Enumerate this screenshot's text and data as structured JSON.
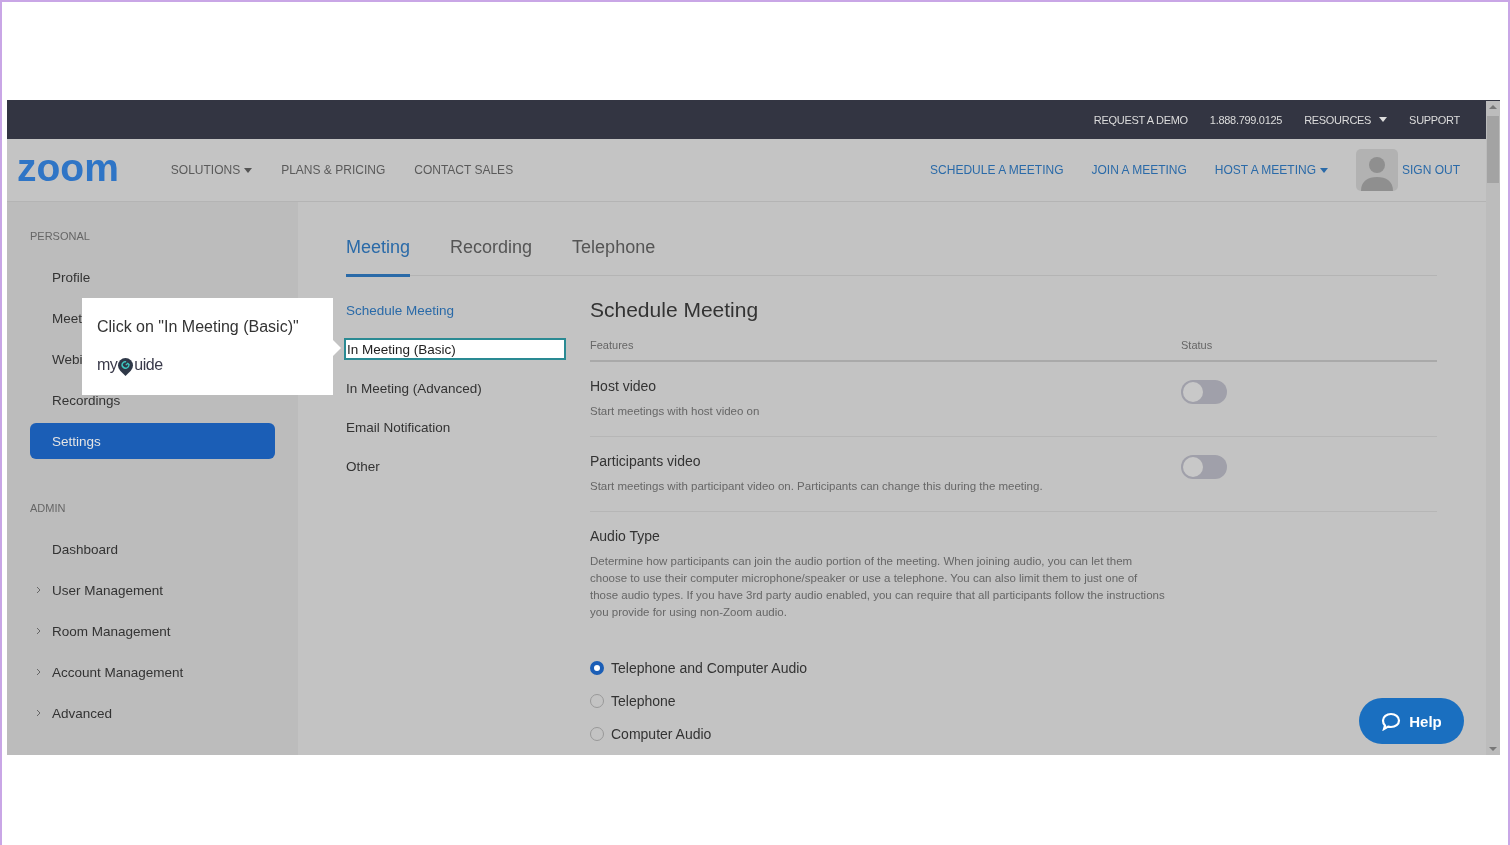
{
  "top_bar": {
    "links": [
      {
        "label": "REQUEST A DEMO",
        "dropdown": false
      },
      {
        "label": "1.888.799.0125",
        "dropdown": false
      },
      {
        "label": "RESOURCES",
        "dropdown": true
      },
      {
        "label": "SUPPORT",
        "dropdown": false
      }
    ]
  },
  "nav": {
    "logo": "zoom",
    "left": [
      {
        "label": "SOLUTIONS",
        "dropdown": true
      },
      {
        "label": "PLANS & PRICING",
        "dropdown": false
      },
      {
        "label": "CONTACT SALES",
        "dropdown": false
      }
    ],
    "right": [
      {
        "label": "SCHEDULE A MEETING",
        "dropdown": false
      },
      {
        "label": "JOIN A MEETING",
        "dropdown": false
      },
      {
        "label": "HOST A MEETING",
        "dropdown": true
      }
    ],
    "sign_out": "SIGN OUT"
  },
  "sidebar": {
    "sections": [
      {
        "heading": "PERSONAL",
        "items": [
          {
            "label": "Profile",
            "selected": false,
            "expandable": false
          },
          {
            "label": "Meet",
            "selected": false,
            "expandable": false
          },
          {
            "label": "Webi",
            "selected": false,
            "expandable": false
          },
          {
            "label": "Recordings",
            "selected": false,
            "expandable": false
          },
          {
            "label": "Settings",
            "selected": true,
            "expandable": false
          }
        ]
      },
      {
        "heading": "ADMIN",
        "items": [
          {
            "label": "Dashboard",
            "selected": false,
            "expandable": false
          },
          {
            "label": "User Management",
            "selected": false,
            "expandable": true
          },
          {
            "label": "Room Management",
            "selected": false,
            "expandable": true
          },
          {
            "label": "Account Management",
            "selected": false,
            "expandable": true
          },
          {
            "label": "Advanced",
            "selected": false,
            "expandable": true
          }
        ]
      }
    ]
  },
  "tabs": [
    {
      "label": "Meeting",
      "selected": true
    },
    {
      "label": "Recording",
      "selected": false
    },
    {
      "label": "Telephone",
      "selected": false
    }
  ],
  "subnav": [
    {
      "label": "Schedule Meeting",
      "selected": true,
      "highlighted": false
    },
    {
      "label": "In Meeting (Basic)",
      "selected": false,
      "highlighted": true
    },
    {
      "label": "In Meeting (Advanced)",
      "selected": false,
      "highlighted": false
    },
    {
      "label": "Email Notification",
      "selected": false,
      "highlighted": false
    },
    {
      "label": "Other",
      "selected": false,
      "highlighted": false
    }
  ],
  "section": {
    "title": "Schedule Meeting",
    "columns": [
      "Features",
      "Status"
    ],
    "settings": [
      {
        "kind": "toggle",
        "name": "Host video",
        "description": "Start meetings with host video on",
        "on": false
      },
      {
        "kind": "toggle",
        "name": "Participants video",
        "description": "Start meetings with participant video on. Participants can change this during the meeting.",
        "on": false
      },
      {
        "kind": "radio",
        "name": "Audio Type",
        "description": "Determine how participants can join the audio portion of the meeting. When joining audio, you can let them choose to use their computer microphone/speaker or use a telephone. You can also limit them to just one of those audio types. If you have 3rd party audio enabled, you can require that all participants follow the instructions you provide for using non-Zoom audio.",
        "options": [
          {
            "label": "Telephone and Computer Audio",
            "selected": true
          },
          {
            "label": "Telephone",
            "selected": false
          },
          {
            "label": "Computer Audio",
            "selected": false
          }
        ]
      }
    ]
  },
  "tooltip": {
    "text": "Click on \"In Meeting (Basic)\"",
    "brand": "myGuide"
  },
  "help_button": {
    "label": "Help"
  }
}
